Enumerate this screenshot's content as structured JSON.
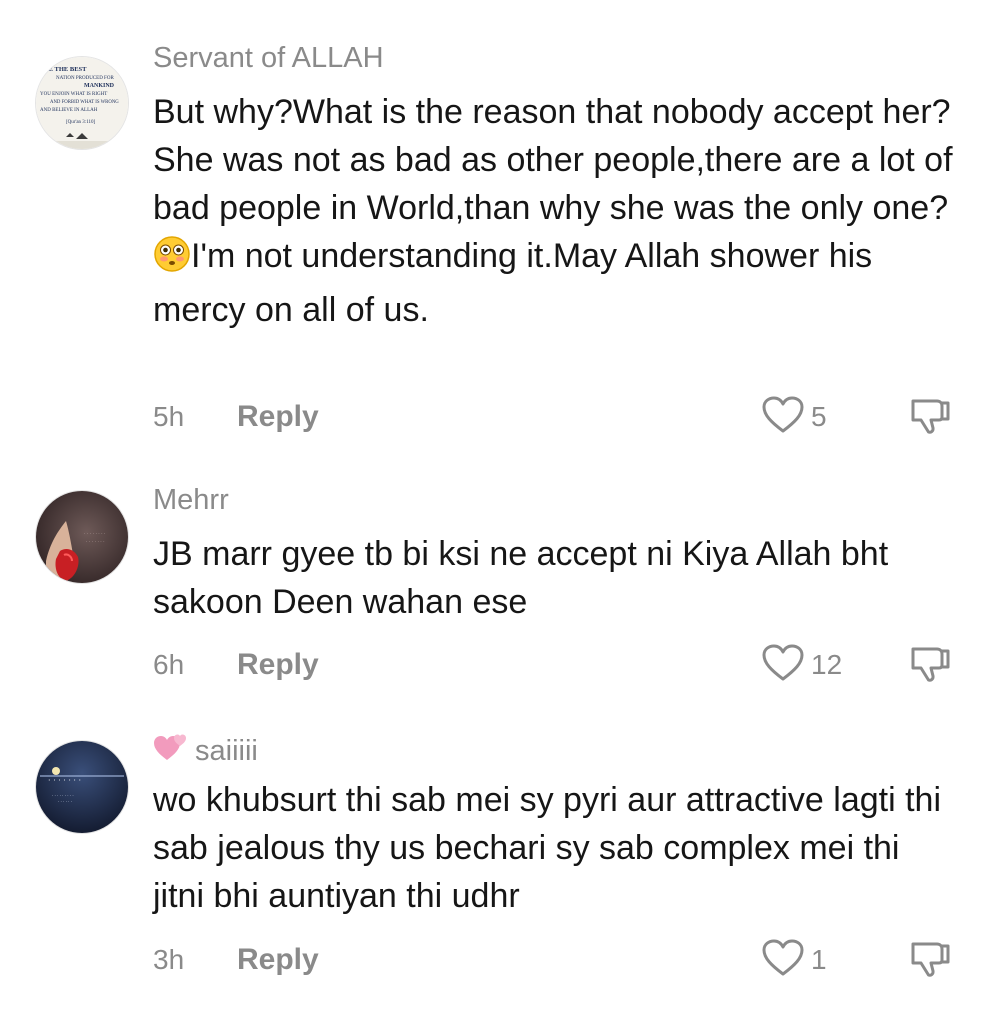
{
  "comments": [
    {
      "username": "Servant of ALLAH",
      "username_prefix": "",
      "avatar_text": [
        "RE THE BEST",
        "NATION PRODUCED FOR",
        "MANKIND",
        "YOU ENJOIN WHAT IS RIGHT",
        "AND FORBID WHAT IS WRONG",
        "AND BELIEVE IN ALLAH",
        "[Qur'an 3:110]"
      ],
      "text_before_emoji": "But why?What is the reason that nobody accept her?She was not as bad as other people,there are a lot of bad people in World,than why she was the only one?",
      "emoji": "flushed-face",
      "text_after_emoji": "I'm not understanding it.May Allah shower his mercy on all of us.",
      "time": "5h",
      "reply_label": "Reply",
      "likes": "5"
    },
    {
      "username": "Mehrr",
      "text": "JB marr gyee tb bi ksi ne accept ni Kiya Allah bht sakoon Deen wahan ese",
      "time": "6h",
      "reply_label": "Reply",
      "likes": "12"
    },
    {
      "username": "saiiiii",
      "username_icon": "two-hearts-icon",
      "text": "wo khubsurt thi sab mei sy pyri aur attractive lagti thi sab jealous thy us bechari sy sab complex mei thi jitni bhi auntiyan thi udhr",
      "time": "3h",
      "reply_label": "Reply",
      "likes": "1"
    }
  ],
  "colors": {
    "meta_gray": "#8a8a8a",
    "text": "#161616",
    "heart_pink": "#f29bbd"
  }
}
